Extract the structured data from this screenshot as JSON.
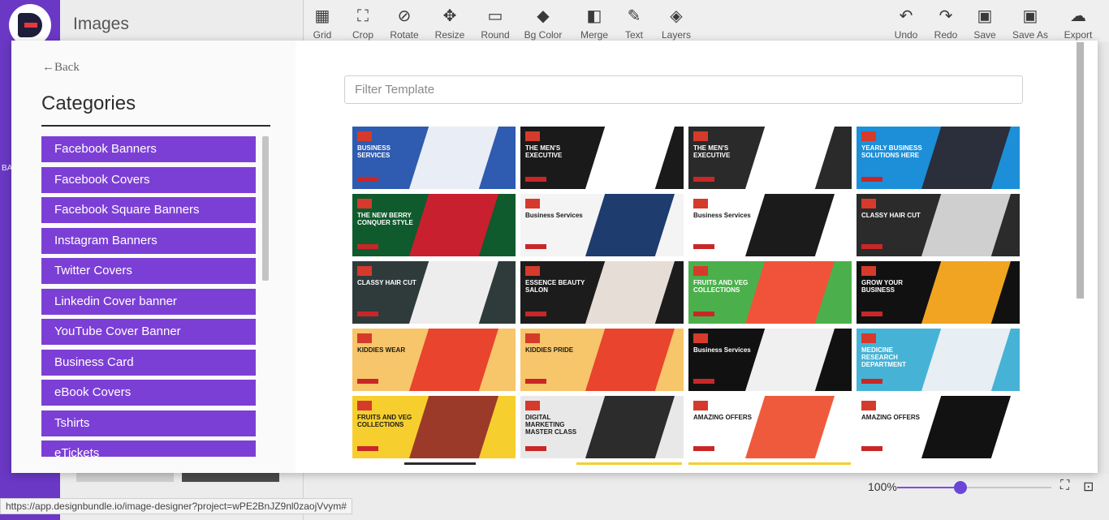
{
  "app": {
    "title": "Images",
    "rail_label": "BA"
  },
  "toolbar": [
    {
      "label": "Grid",
      "icon": "grid-icon",
      "glyph": "▦"
    },
    {
      "label": "Crop",
      "icon": "crop-icon",
      "glyph": "⛶"
    },
    {
      "label": "Rotate",
      "icon": "rotate-icon",
      "glyph": "⊘"
    },
    {
      "label": "Resize",
      "icon": "resize-icon",
      "glyph": "✥"
    },
    {
      "label": "Round",
      "icon": "round-icon",
      "glyph": "▭"
    },
    {
      "label": "Bg Color",
      "icon": "bg-color-icon",
      "glyph": "◆"
    },
    {
      "label": "Merge",
      "icon": "merge-icon",
      "glyph": "◧"
    },
    {
      "label": "Text",
      "icon": "text-icon",
      "glyph": "✎"
    },
    {
      "label": "Layers",
      "icon": "layers-icon",
      "glyph": "◈"
    },
    {
      "label": "Undo",
      "icon": "undo-icon",
      "glyph": "↶"
    },
    {
      "label": "Redo",
      "icon": "redo-icon",
      "glyph": "↷"
    },
    {
      "label": "Save",
      "icon": "save-icon",
      "glyph": "▣"
    },
    {
      "label": "Save As",
      "icon": "save-as-icon",
      "glyph": "▣"
    },
    {
      "label": "Export",
      "icon": "export-icon",
      "glyph": "☁"
    }
  ],
  "modal": {
    "back_label": "Back",
    "categories_title": "Categories",
    "filter_placeholder": "Filter Template",
    "categories": [
      "Facebook Banners",
      "Facebook Covers",
      "Facebook Square Banners",
      "Instagram Banners",
      "Twitter Covers",
      "Linkedin Cover banner",
      "YouTube Cover Banner",
      "Business Card",
      "eBook Covers",
      "Tshirts",
      "eTickets"
    ]
  },
  "zoom": {
    "label": "100%",
    "level": 0.41
  },
  "status_url": "https://app.designbundle.io/image-designer?project=wPE2BnJZ9nl0zaojVvym#",
  "colors": {
    "accent": "#7c3fd6",
    "rail": "#6a38c4"
  },
  "templates": [
    {
      "theme": "business services",
      "bg": "#2f5bb0",
      "photo": "#e9eef6",
      "label": "BUSINESS SERVICES"
    },
    {
      "theme": "the men's executive",
      "bg": "#1a1a1a",
      "photo": "#ffffff",
      "label": "THE MEN'S EXECUTIVE"
    },
    {
      "theme": "the men's executive dark",
      "bg": "#2a2a2a",
      "photo": "#ffffff",
      "label": "THE MEN'S EXECUTIVE"
    },
    {
      "theme": "yearly business solutions 2018",
      "bg": "#1d8fd8",
      "photo": "#2a2f3b",
      "label": "YEARLY BUSINESS SOLUTIONS HERE"
    },
    {
      "theme": "the new berry conquer style",
      "bg": "#0f5b2e",
      "photo": "#c8202e",
      "label": "THE NEW BERRY CONQUER STYLE"
    },
    {
      "theme": "business services blue",
      "bg": "#f4f4f4",
      "photo": "#1e3c6e",
      "label": "Business Services"
    },
    {
      "theme": "business services orange",
      "bg": "#ffffff",
      "photo": "#1b1b1b",
      "label": "Business Services"
    },
    {
      "theme": "classy hair cut",
      "bg": "#2b2b2b",
      "photo": "#cfcfcf",
      "label": "CLASSY HAIR CUT"
    },
    {
      "theme": "classy hair cut 2",
      "bg": "#2f3b3b",
      "photo": "#ededed",
      "label": "CLASSY HAIR CUT"
    },
    {
      "theme": "essence beauty salon",
      "bg": "#1c1c1c",
      "photo": "#e6ddd6",
      "label": "ESSENCE BEAUTY SALON"
    },
    {
      "theme": "fruits and veg collections",
      "bg": "#4bb04b",
      "photo": "#f0533a",
      "label": "FRUITS AND VEG COLLECTIONS"
    },
    {
      "theme": "grow your business",
      "bg": "#111111",
      "photo": "#f1a421",
      "label": "GROW YOUR BUSINESS"
    },
    {
      "theme": "kiddies wear 50 off",
      "bg": "#f7c56a",
      "photo": "#e8442e",
      "label": "KIDDIES WEAR"
    },
    {
      "theme": "kiddies pride 50 off",
      "bg": "#f7c56a",
      "photo": "#e8442e",
      "label": "KIDDIES PRIDE"
    },
    {
      "theme": "business services black",
      "bg": "#111111",
      "photo": "#f0f0f0",
      "label": "Business Services"
    },
    {
      "theme": "medicine research department",
      "bg": "#46b3d6",
      "photo": "#e7eef4",
      "label": "MEDICINE RESEARCH DEPARTMENT"
    },
    {
      "theme": "fruits and veg collections yellow",
      "bg": "#f6cf2e",
      "photo": "#9c3a2a",
      "label": "FRUITS AND VEG COLLECTIONS"
    },
    {
      "theme": "digital marketing master class",
      "bg": "#e8e8e8",
      "photo": "#2c2c2c",
      "label": "DIGITAL MARKETING MASTER CLASS"
    },
    {
      "theme": "amazing offers",
      "bg": "#ffffff",
      "photo": "#f05a3c",
      "label": "AMAZING OFFERS"
    },
    {
      "theme": "amazing offers 2",
      "bg": "#ffffff",
      "photo": "#121212",
      "label": "AMAZING OFFERS"
    }
  ]
}
